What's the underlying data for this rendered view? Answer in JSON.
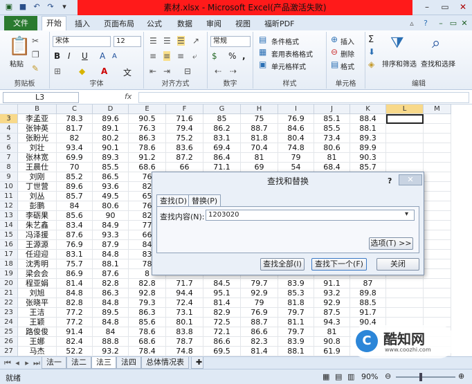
{
  "window": {
    "title": "素材.xlsx - Microsoft Excel(产品激活失败)"
  },
  "ribbon_tabs": {
    "file": "文件",
    "tabs": [
      "开始",
      "插入",
      "页面布局",
      "公式",
      "数据",
      "审阅",
      "视图",
      "福昕PDF"
    ]
  },
  "ribbon": {
    "clipboard": {
      "label": "剪贴板",
      "paste": "粘贴"
    },
    "font": {
      "label": "字体",
      "name": "宋体",
      "size": "12",
      "bold": "B",
      "italic": "I",
      "underline": "U",
      "wen": "文"
    },
    "align": {
      "label": "对齐方式"
    },
    "number": {
      "label": "数字",
      "format": "常规",
      "pct": "%",
      "comma": ","
    },
    "styles": {
      "label": "样式",
      "cond": "条件格式",
      "table": "套用表格格式",
      "cell": "单元格样式"
    },
    "cells": {
      "label": "单元格",
      "insert": "插入",
      "delete": "删除",
      "format": "格式"
    },
    "editing": {
      "label": "编辑",
      "sort": "排序和筛选",
      "find": "查找和选择"
    }
  },
  "formula_bar": {
    "name_box": "L3",
    "fx": "fx"
  },
  "columns": [
    "B",
    "C",
    "D",
    "E",
    "F",
    "G",
    "H",
    "I",
    "J",
    "K",
    "L",
    "M"
  ],
  "rows": [
    {
      "n": "3",
      "cells": [
        "李孟亚",
        "78.3",
        "89.6",
        "90.5",
        "71.6",
        "85",
        "75",
        "76.9",
        "85.1",
        "88.4"
      ]
    },
    {
      "n": "4",
      "cells": [
        "张钟英",
        "81.7",
        "89.1",
        "76.3",
        "79.4",
        "86.2",
        "88.7",
        "84.6",
        "85.5",
        "88.1"
      ]
    },
    {
      "n": "5",
      "cells": [
        "张盼光",
        "82",
        "80.2",
        "86.3",
        "75.2",
        "83.1",
        "81.8",
        "80.4",
        "73.4",
        "89.3"
      ]
    },
    {
      "n": "6",
      "cells": [
        "刘壮",
        "93.4",
        "90.1",
        "78.6",
        "83.6",
        "69.4",
        "70.4",
        "74.8",
        "80.6",
        "89.9"
      ]
    },
    {
      "n": "7",
      "cells": [
        "张林宽",
        "69.9",
        "89.3",
        "91.2",
        "87.2",
        "86.4",
        "81",
        "79",
        "81",
        "90.3"
      ]
    },
    {
      "n": "8",
      "cells": [
        "王晨仕",
        "70",
        "85.5",
        "68.6",
        "66",
        "71.1",
        "69",
        "54",
        "68.4",
        "85.7"
      ]
    },
    {
      "n": "9",
      "cells": [
        "刘刚",
        "85.2",
        "86.5",
        "76",
        "",
        "",
        "",
        "",
        "",
        ""
      ]
    },
    {
      "n": "10",
      "cells": [
        "丁世营",
        "89.6",
        "93.6",
        "82",
        "",
        "",
        "",
        "",
        "",
        ""
      ]
    },
    {
      "n": "11",
      "cells": [
        "刘丛",
        "85.7",
        "49.5",
        "65",
        "",
        "",
        "",
        "",
        "",
        ""
      ]
    },
    {
      "n": "12",
      "cells": [
        "彭鹏",
        "84",
        "80.6",
        "76",
        "",
        "",
        "",
        "",
        "",
        ""
      ]
    },
    {
      "n": "13",
      "cells": [
        "李砺果",
        "85.6",
        "90",
        "82",
        "",
        "",
        "",
        "",
        "",
        ""
      ]
    },
    {
      "n": "14",
      "cells": [
        "朱艺鑫",
        "83.4",
        "84.9",
        "77",
        "",
        "",
        "",
        "",
        "",
        ""
      ]
    },
    {
      "n": "15",
      "cells": [
        "冯泽援",
        "87.6",
        "93.3",
        "66",
        "",
        "",
        "",
        "",
        "",
        ""
      ]
    },
    {
      "n": "16",
      "cells": [
        "王源源",
        "76.9",
        "87.9",
        "84",
        "",
        "",
        "",
        "",
        "",
        ""
      ]
    },
    {
      "n": "17",
      "cells": [
        "任迎迎",
        "83.1",
        "84.8",
        "83",
        "",
        "",
        "",
        "",
        "",
        ""
      ]
    },
    {
      "n": "18",
      "cells": [
        "沈秀明",
        "75.7",
        "88.1",
        "78",
        "",
        "",
        "",
        "",
        "",
        ""
      ]
    },
    {
      "n": "19",
      "cells": [
        "梁会会",
        "86.9",
        "87.6",
        "8",
        "",
        "",
        "",
        "",
        "",
        ""
      ]
    },
    {
      "n": "20",
      "cells": [
        "程亚娟",
        "81.4",
        "82.8",
        "82.8",
        "71.7",
        "84.5",
        "79.7",
        "83.9",
        "91.1",
        "87"
      ]
    },
    {
      "n": "21",
      "cells": [
        "刘旭",
        "84.8",
        "86.3",
        "92.8",
        "94.4",
        "95.1",
        "92.9",
        "85.3",
        "93.2",
        "89.8"
      ]
    },
    {
      "n": "22",
      "cells": [
        "张晓平",
        "82.8",
        "84.8",
        "79.3",
        "72.4",
        "81.4",
        "79",
        "81.8",
        "92.9",
        "88.5"
      ]
    },
    {
      "n": "23",
      "cells": [
        "王洁",
        "77.2",
        "89.5",
        "86.3",
        "73.1",
        "82.9",
        "76.9",
        "79.7",
        "87.5",
        "91.7"
      ]
    },
    {
      "n": "24",
      "cells": [
        "王颖",
        "77.2",
        "84.8",
        "85.6",
        "80.1",
        "72.5",
        "88.7",
        "81.1",
        "94.3",
        "90.4"
      ]
    },
    {
      "n": "25",
      "cells": [
        "路俊俊",
        "91.4",
        "84",
        "78.6",
        "83.8",
        "72.1",
        "86.6",
        "79.7",
        "81",
        ""
      ]
    },
    {
      "n": "26",
      "cells": [
        "王娜",
        "82.4",
        "88.8",
        "68.6",
        "78.7",
        "86.6",
        "82.3",
        "83.9",
        "90.8",
        ""
      ]
    },
    {
      "n": "27",
      "cells": [
        "马杰",
        "52.2",
        "93.2",
        "78.4",
        "74.8",
        "69.5",
        "81.4",
        "88.1",
        "61.9",
        ""
      ]
    }
  ],
  "sheet_tabs": [
    "法一",
    "法二",
    "法三",
    "法四",
    "总体情况表"
  ],
  "status": {
    "ready": "就绪",
    "zoom": "90%"
  },
  "dialog": {
    "title": "查找和替换",
    "help": "?",
    "tab_find": "查找(D)",
    "tab_replace": "替换(P)",
    "find_label": "查找内容(N):",
    "find_value": "1203020",
    "options": "选项(T) >>",
    "find_all": "查找全部(I)",
    "find_next": "查找下一个(F)",
    "close": "关闭"
  },
  "watermark": {
    "brand": "酷知网",
    "url": "www.coozhi.com"
  }
}
